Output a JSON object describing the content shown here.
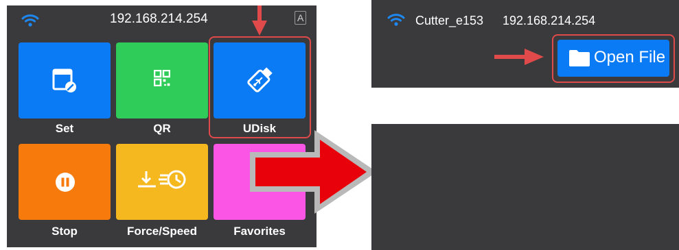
{
  "left_screen": {
    "ip_address": "192.168.214.254",
    "font_icon_glyph": "A",
    "tiles": [
      {
        "label": "Set",
        "color": "#0a7bf5",
        "icon": "settings-window-icon"
      },
      {
        "label": "QR",
        "color": "#2fcc5a",
        "icon": "qr-code-icon"
      },
      {
        "label": "UDisk",
        "color": "#0a7bf5",
        "icon": "usb-drive-icon"
      },
      {
        "label": "Stop",
        "color": "#f77a0d",
        "icon": "pause-icon"
      },
      {
        "label": "Force/Speed",
        "color": "#f6b81f",
        "icon": "force-speed-icon"
      },
      {
        "label": "Favorites",
        "color": "#fb55e6",
        "icon": "favorites-icon"
      }
    ]
  },
  "right_screen": {
    "device_name": "Cutter_e153",
    "ip_address": "192.168.214.254",
    "open_file_label": "Open File"
  },
  "colors": {
    "screen_background": "#3a3a3c",
    "wifi": "#1e88f2",
    "annotation_red": "#e04a4a",
    "big_arrow_red": "#e8000a",
    "big_arrow_outline": "#b9b9b9"
  }
}
